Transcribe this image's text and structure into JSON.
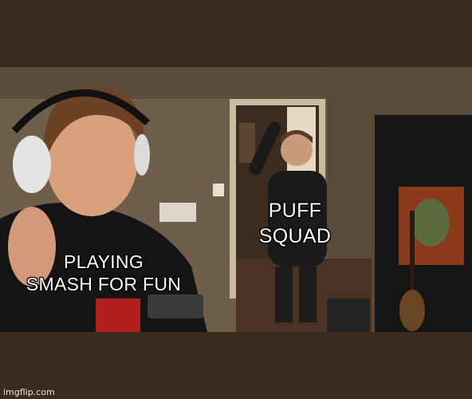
{
  "meme": {
    "caption_left": "PLAYING\nSMASH FOR FUN",
    "caption_left_lines": [
      "PLAYING",
      "SMASH FOR FUN"
    ],
    "caption_right_lines": [
      "PUFF",
      "SQUAD"
    ],
    "watermark": "imgflip.com"
  },
  "colors": {
    "band": "#3b2b1f",
    "wall": "#7a6a55",
    "caption_text": "#ffffff"
  }
}
